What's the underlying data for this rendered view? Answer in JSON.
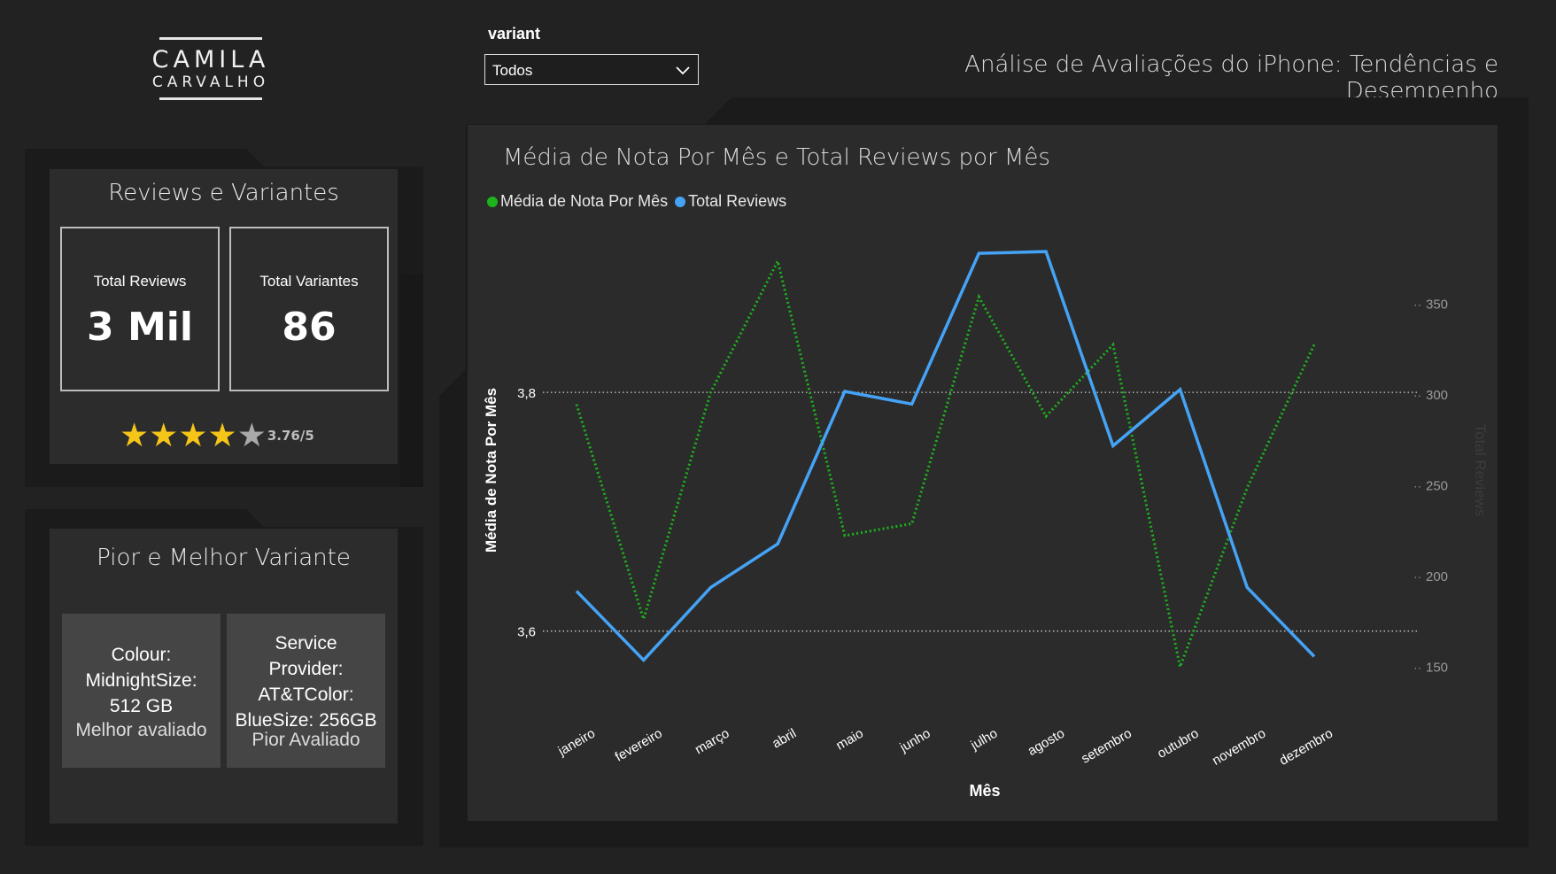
{
  "logo": {
    "line1": "CAMILA",
    "line2": "CARVALHO"
  },
  "slicer": {
    "label": "variant",
    "value": "Todos",
    "icon": "chevron-down-icon"
  },
  "page_title": "Análise de Avaliações do iPhone: Tendências e Desempenho",
  "reviews_panel": {
    "title": "Reviews e Variantes",
    "cards": [
      {
        "label": "Total Reviews",
        "value": "3 Mil"
      },
      {
        "label": "Total Variantes",
        "value": "86"
      }
    ],
    "rating": {
      "text": "3.76/5",
      "value": 3.76,
      "max": 5
    }
  },
  "variant_panel": {
    "title": "Pior e Melhor Variante",
    "best": {
      "lines": [
        "Colour:",
        "MidnightSize:",
        "512 GB"
      ],
      "caption": "Melhor avaliado"
    },
    "worst": {
      "lines": [
        "Service",
        "Provider:",
        "AT&TColor:",
        "BlueSize: 256GB"
      ],
      "caption": "Pior Avaliado"
    }
  },
  "colors": {
    "green": "#1db31d",
    "blue": "#45a3f5",
    "star": "#f5c518"
  },
  "chart_data": {
    "type": "line",
    "title": "Média de Nota Por Mês e Total Reviews por Mês",
    "xlabel": "Mês",
    "ylabel": "Média de Nota Por Mês",
    "y2label": "Total Reviews",
    "categories": [
      "janeiro",
      "fevereiro",
      "março",
      "abril",
      "maio",
      "junho",
      "julho",
      "agosto",
      "setembro",
      "outubro",
      "novembro",
      "dezembro"
    ],
    "y_ticks": [
      "3,6",
      "3,8"
    ],
    "y_ticks_values": [
      3.6,
      3.8
    ],
    "ylim": [
      3.53,
      3.95
    ],
    "y2_ticks": [
      "150",
      "200",
      "250",
      "300",
      "350"
    ],
    "y2lim": [
      124,
      400
    ],
    "legend_position": "top-left",
    "series": [
      {
        "name": "Média de Nota Por Mês",
        "axis": "left",
        "style": "dotted",
        "color": "#1db31d",
        "values": [
          3.79,
          3.61,
          3.8,
          3.91,
          3.68,
          3.69,
          3.88,
          3.78,
          3.84,
          3.57,
          3.72,
          3.84
        ]
      },
      {
        "name": "Total Reviews",
        "axis": "right",
        "style": "solid",
        "color": "#45a3f5",
        "values": [
          192,
          154,
          194,
          218,
          302,
          295,
          378,
          379,
          272,
          303,
          194,
          156
        ]
      }
    ]
  }
}
